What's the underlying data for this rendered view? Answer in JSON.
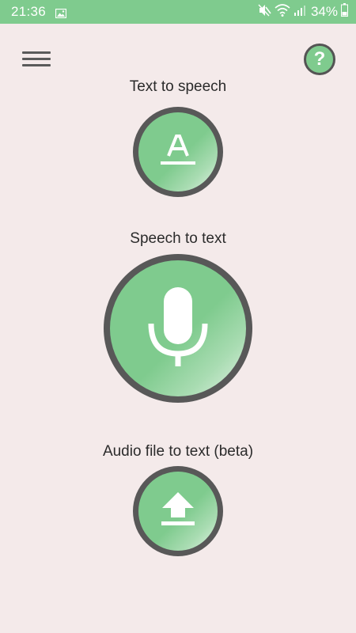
{
  "status_bar": {
    "time": "21:36",
    "battery": "34%",
    "icons": [
      "gallery-icon",
      "mute-icon",
      "wifi-icon",
      "signal-icon",
      "battery-icon"
    ]
  },
  "header": {
    "menu_icon": "hamburger-menu-icon",
    "help_label": "?",
    "help_icon": "help-icon"
  },
  "actions": {
    "text_to_speech": {
      "label": "Text to speech",
      "icon": "text-letter-icon"
    },
    "speech_to_text": {
      "label": "Speech to text",
      "icon": "microphone-icon"
    },
    "audio_file_to_text": {
      "label": "Audio file to text (beta)",
      "icon": "upload-icon"
    }
  },
  "colors": {
    "accent": "#7fcb8e",
    "ring": "#585858",
    "background": "#f4eaea",
    "text": "#2b2b2b"
  }
}
